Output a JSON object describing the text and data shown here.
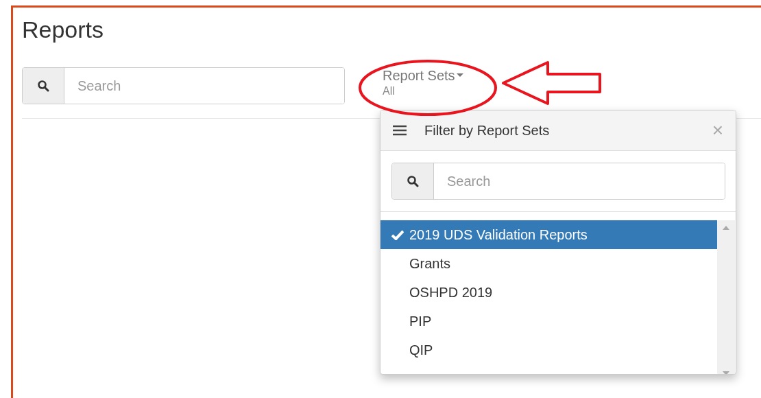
{
  "page": {
    "title": "Reports"
  },
  "search": {
    "placeholder": "Search"
  },
  "report_sets": {
    "label": "Report Sets",
    "value": "All"
  },
  "filter_panel": {
    "title": "Filter by Report Sets",
    "close": "×",
    "search": {
      "placeholder": "Search"
    },
    "items": [
      {
        "label": "2019 UDS Validation Reports",
        "selected": true
      },
      {
        "label": "Grants",
        "selected": false
      },
      {
        "label": "OSHPD 2019",
        "selected": false
      },
      {
        "label": "PIP",
        "selected": false
      },
      {
        "label": "QIP",
        "selected": false
      }
    ]
  }
}
